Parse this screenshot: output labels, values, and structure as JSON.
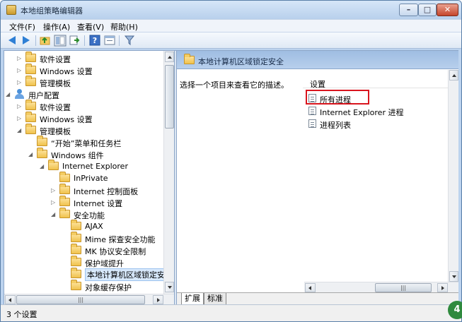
{
  "window": {
    "title": "本地组策略编辑器"
  },
  "menu": {
    "file": "文件(F)",
    "action": "操作(A)",
    "view": "查看(V)",
    "help": "帮助(H)"
  },
  "tree": [
    {
      "label": "软件设置",
      "indent": 1,
      "expander": "▷",
      "icon": "folder"
    },
    {
      "label": "Windows 设置",
      "indent": 1,
      "expander": "▷",
      "icon": "folder"
    },
    {
      "label": "管理模板",
      "indent": 1,
      "expander": "▷",
      "icon": "folder"
    },
    {
      "label": "用户配置",
      "indent": 0,
      "expander": "◢",
      "icon": "user"
    },
    {
      "label": "软件设置",
      "indent": 1,
      "expander": "▷",
      "icon": "folder"
    },
    {
      "label": "Windows 设置",
      "indent": 1,
      "expander": "▷",
      "icon": "folder"
    },
    {
      "label": "管理模板",
      "indent": 1,
      "expander": "◢",
      "icon": "folder"
    },
    {
      "label": "“开始”菜单和任务栏",
      "indent": 2,
      "expander": "",
      "icon": "folder"
    },
    {
      "label": "Windows 组件",
      "indent": 2,
      "expander": "◢",
      "icon": "folder"
    },
    {
      "label": "Internet Explorer",
      "indent": 3,
      "expander": "◢",
      "icon": "folder"
    },
    {
      "label": "InPrivate",
      "indent": 4,
      "expander": "",
      "icon": "folder"
    },
    {
      "label": "Internet 控制面板",
      "indent": 4,
      "expander": "▷",
      "icon": "folder"
    },
    {
      "label": "Internet 设置",
      "indent": 4,
      "expander": "▷",
      "icon": "folder"
    },
    {
      "label": "安全功能",
      "indent": 4,
      "expander": "◢",
      "icon": "folder"
    },
    {
      "label": "AJAX",
      "indent": 5,
      "expander": "",
      "icon": "folder"
    },
    {
      "label": "Mime 探查安全功能",
      "indent": 5,
      "expander": "",
      "icon": "folder"
    },
    {
      "label": "MK 协议安全限制",
      "indent": 5,
      "expander": "",
      "icon": "folder"
    },
    {
      "label": "保护域提升",
      "indent": 5,
      "expander": "",
      "icon": "folder"
    },
    {
      "label": "本地计算机区域锁定安",
      "indent": 5,
      "expander": "",
      "icon": "folder",
      "selected": true
    },
    {
      "label": "对象缓存保护",
      "indent": 5,
      "expander": "",
      "icon": "folder"
    }
  ],
  "right_pane": {
    "header_title": "本地计算机区域锁定安全",
    "description": "选择一个项目来查看它的描述。",
    "column_header": "设置",
    "items": [
      "所有进程",
      "Internet Explorer 进程",
      "进程列表"
    ],
    "highlighted_item": "所有进程"
  },
  "tabs": {
    "extended": "扩展",
    "standard": "标准",
    "active": "扩展"
  },
  "status": {
    "text": "3 个设置"
  },
  "badge": {
    "text": "4"
  }
}
